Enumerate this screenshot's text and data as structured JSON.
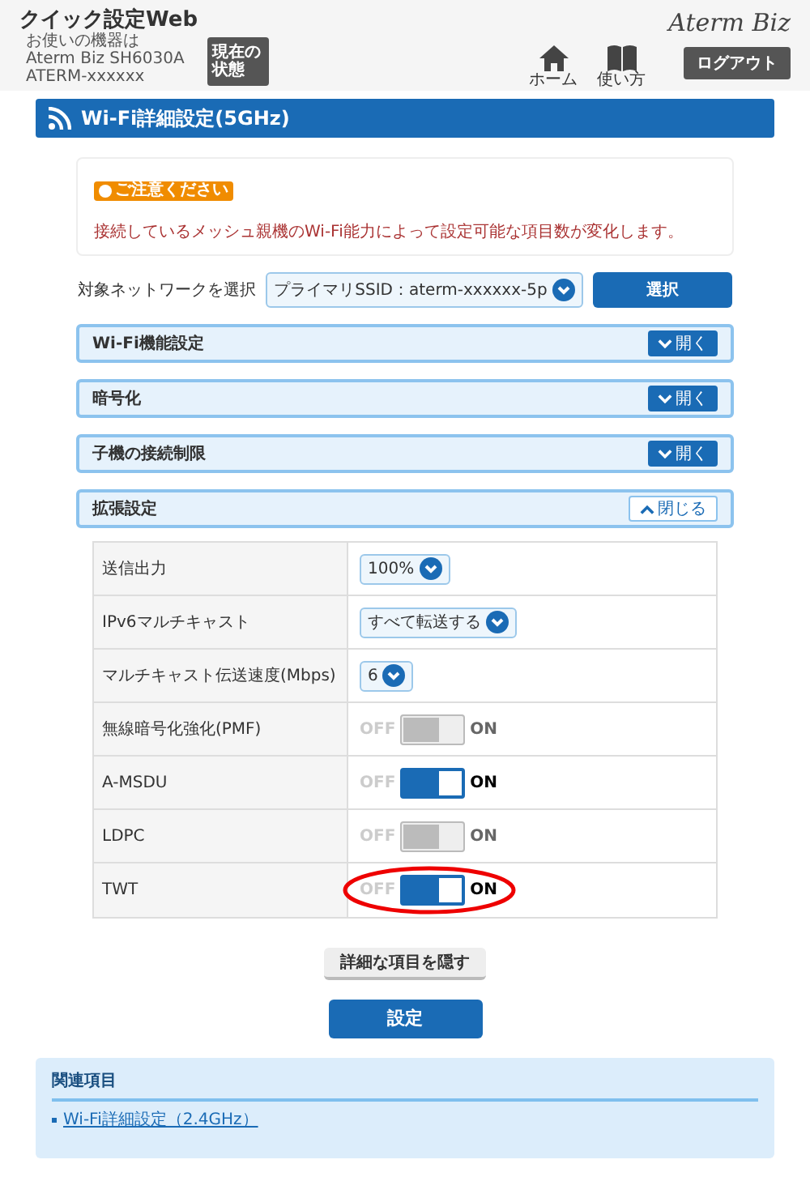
{
  "header": {
    "title": "クイック設定Web",
    "device_lines": [
      "お使いの機器は",
      "Aterm Biz SH6030A",
      "ATERM-xxxxxx"
    ],
    "status_button": "現在の状態",
    "nav": [
      {
        "kind": "home",
        "label": "ホーム"
      },
      {
        "kind": "guide",
        "label": "使い方"
      }
    ],
    "logo": "Aterm Biz",
    "logout": "ログアウト"
  },
  "page_title": "Wi-Fi詳細設定(5GHz)",
  "notice": {
    "badge": "ご注意ください",
    "text": "接続しているメッシュ親機のWi-Fi能力によって設定可能な項目数が変化します。"
  },
  "network_select": {
    "label": "対象ネットワークを選択",
    "value": "プライマリSSID：aterm-xxxxxx-5p",
    "button": "選択"
  },
  "sections": [
    {
      "title": "Wi-Fi機能設定",
      "button": "開く",
      "expanded": false
    },
    {
      "title": "暗号化",
      "button": "開く",
      "expanded": false
    },
    {
      "title": "子機の接続制限",
      "button": "開く",
      "expanded": false
    },
    {
      "title": "拡張設定",
      "button": "閉じる",
      "expanded": true
    }
  ],
  "settings": [
    {
      "kind": "select",
      "label": "送信出力",
      "value": "100%"
    },
    {
      "kind": "select",
      "label": "IPv6マルチキャスト",
      "value": "すべて転送する"
    },
    {
      "kind": "select",
      "label": "マルチキャスト伝送速度(Mbps)",
      "value": "6"
    },
    {
      "kind": "toggle",
      "label": "無線暗号化強化(PMF)",
      "off_label": "OFF",
      "on_label": "ON",
      "on": false,
      "highlighted": false
    },
    {
      "kind": "toggle",
      "label": "A-MSDU",
      "off_label": "OFF",
      "on_label": "ON",
      "on": true,
      "highlighted": false
    },
    {
      "kind": "toggle",
      "label": "LDPC",
      "off_label": "OFF",
      "on_label": "ON",
      "on": false,
      "highlighted": false
    },
    {
      "kind": "toggle",
      "label": "TWT",
      "off_label": "OFF",
      "on_label": "ON",
      "on": true,
      "highlighted": true
    }
  ],
  "hide_details_button": "詳細な項目を隠す",
  "submit_button": "設定",
  "related": {
    "title": "関連項目",
    "links": [
      "Wi-Fi詳細設定（2.4GHz）"
    ]
  }
}
